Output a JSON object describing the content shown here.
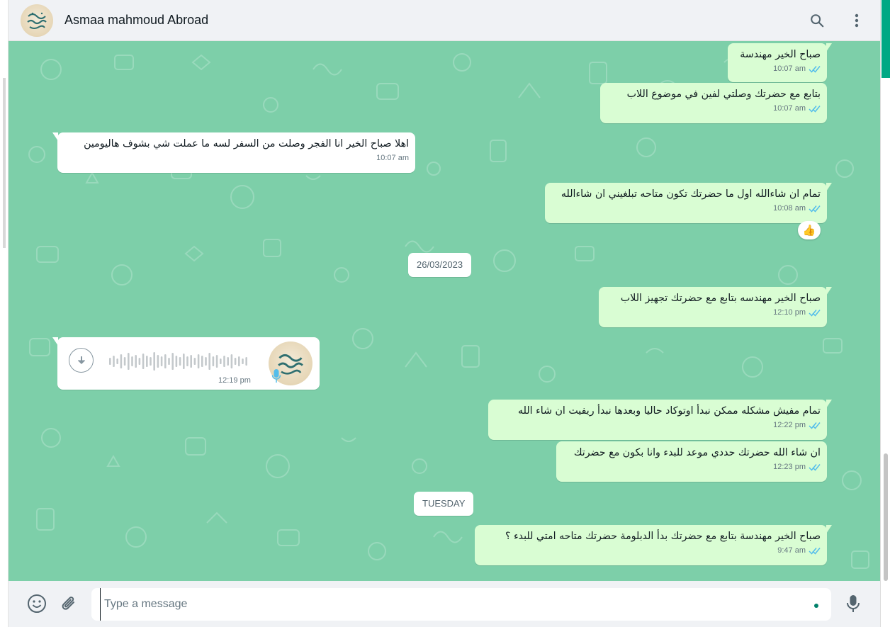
{
  "header": {
    "contact_name": "Asmaa mahmoud Abroad"
  },
  "icons": {
    "search": "search-icon",
    "menu": "menu-dots-icon",
    "emoji": "emoji-icon",
    "attach": "paperclip-icon",
    "mic": "mic-icon",
    "download": "download-icon"
  },
  "colors": {
    "chat_bg": "#7dcfa9",
    "outgoing_bubble": "#d9fdd3",
    "incoming_bubble": "#ffffff",
    "tick_blue": "#53bdeb",
    "accent": "#00a884"
  },
  "messages": [
    {
      "dir": "out",
      "text": "صباح الخير مهندسة",
      "time": "10:07 am"
    },
    {
      "dir": "out",
      "text": "بتابع مع حضرتك وصلتي لفين في موضوع اللاب",
      "time": "10:07 am"
    },
    {
      "dir": "in",
      "text": "اهلا صباح الخير انا الفجر وصلت من السفر لسه ما عملت شي بشوف هاليومين",
      "time": "10:07 am"
    },
    {
      "dir": "out",
      "text": "تمام ان شاءالله اول ما حضرتك تكون متاحه تبلغيني ان شاءالله",
      "time": "10:08 am",
      "reaction": "👍"
    },
    {
      "dir": "out",
      "text": "صباح الخير مهندسه بتابع مع حضرتك تجهيز اللاب",
      "time": "12:10 pm"
    },
    {
      "dir": "in",
      "type": "voice",
      "time": "12:19 pm"
    },
    {
      "dir": "out",
      "text": "تمام مفيش مشكله  ممكن نبدأ اوتوكاد حاليا وبعدها نبدأ ريفيت ان شاء الله",
      "time": "12:22 pm"
    },
    {
      "dir": "out",
      "text": "ان شاء الله حضرتك حددي موعد للبدء وانا بكون مع حضرتك",
      "time": "12:23 pm"
    },
    {
      "dir": "out",
      "text": "صباح الخير مهندسة بتابع مع حضرتك بدأ الدبلومة حضرتك متاحه امتي للبدء ؟",
      "time": "9:47 am"
    }
  ],
  "date_chips": [
    "26/03/2023",
    "TUESDAY"
  ],
  "composer": {
    "placeholder": "Type a message"
  }
}
